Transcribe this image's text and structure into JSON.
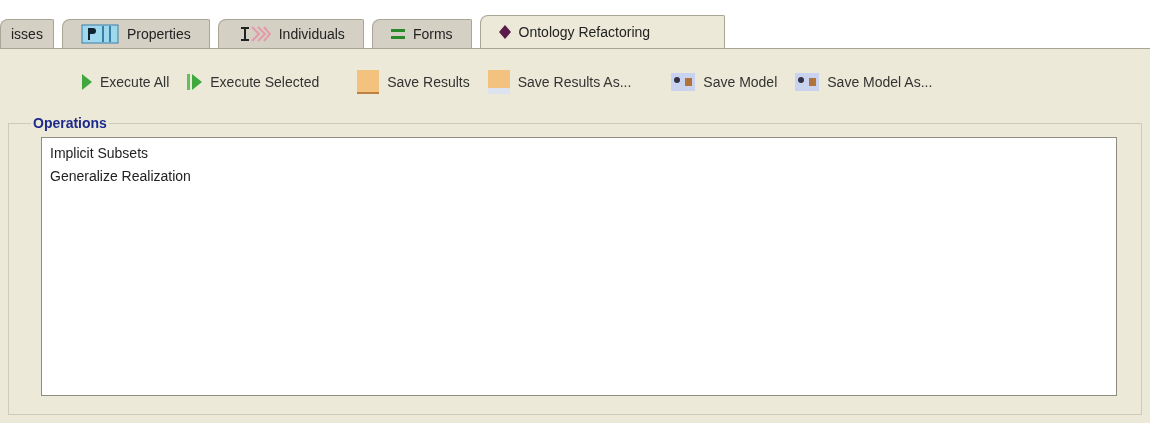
{
  "tabs": [
    {
      "label": "isses",
      "selected": false
    },
    {
      "label": "Properties",
      "selected": false
    },
    {
      "label": "Individuals",
      "selected": false
    },
    {
      "label": "Forms",
      "selected": false
    },
    {
      "label": "Ontology Refactoring",
      "selected": true
    }
  ],
  "toolbar": [
    {
      "label": "Execute All"
    },
    {
      "label": "Execute Selected"
    },
    {
      "label": "Save Results"
    },
    {
      "label": "Save Results As..."
    },
    {
      "label": "Save Model"
    },
    {
      "label": "Save Model As..."
    }
  ],
  "operations": {
    "title": "Operations",
    "items": [
      {
        "label": "Implicit Subsets",
        "selected": false
      },
      {
        "label": "Generalize Realization",
        "selected": false
      }
    ]
  }
}
